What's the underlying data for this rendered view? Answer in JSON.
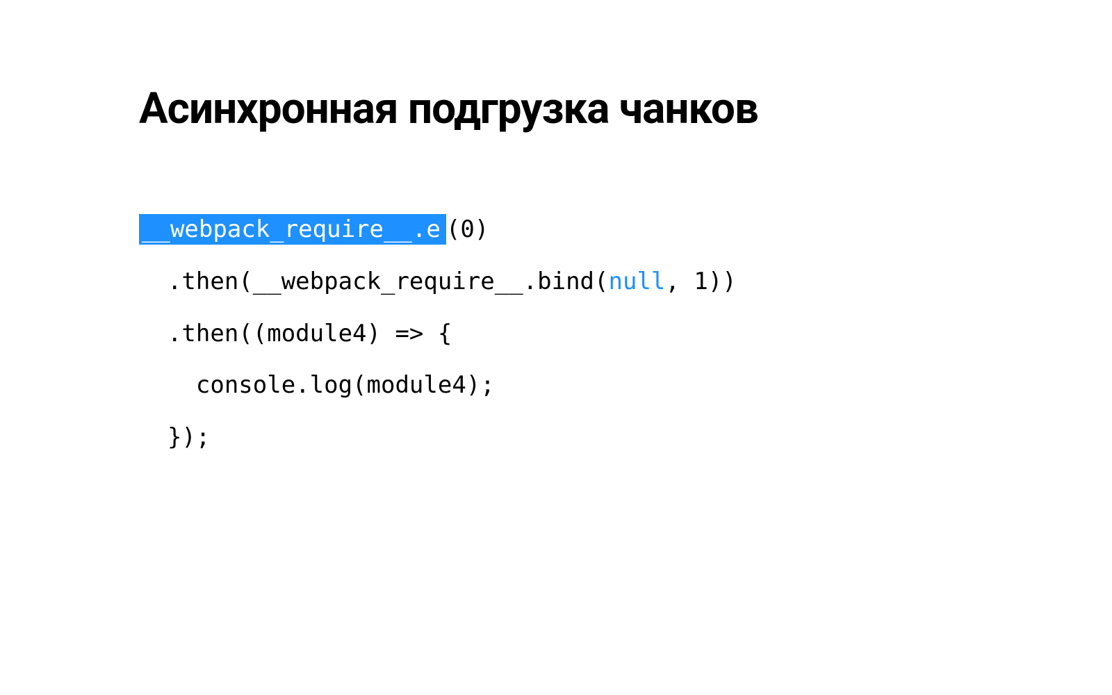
{
  "slide": {
    "title": "Асинхронная подгрузка чанков",
    "code": {
      "line1_hl": "__webpack_require__.e",
      "line1_rest": "(0)",
      "line2_a": "  .then(__webpack_require__.bind(",
      "line2_kw": "null",
      "line2_b": ", 1))",
      "line3": "  .then((module4) => {",
      "line4": "    console.log(module4);",
      "line5": "  });"
    }
  },
  "colors": {
    "highlight_bg": "#1e90ff",
    "highlight_fg": "#ffffff",
    "keyword": "#1e90ff",
    "text": "#000000",
    "background": "#ffffff"
  }
}
